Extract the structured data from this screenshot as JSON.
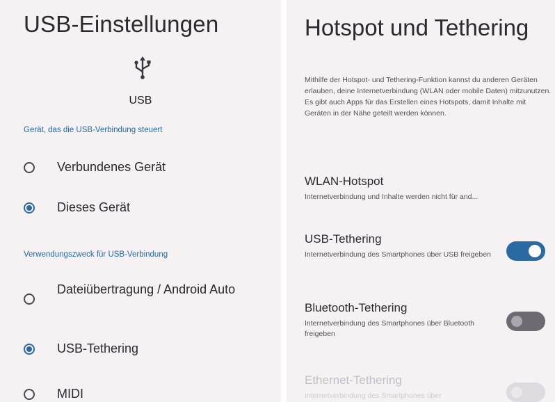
{
  "usb_settings": {
    "title": "USB-Einstellungen",
    "icon": "usb-icon",
    "usb_label": "USB",
    "controller_header": "Gerät, das die USB-Verbindung steuert",
    "controller_options": [
      {
        "label": "Verbundenes Gerät",
        "checked": false
      },
      {
        "label": "Dieses Gerät",
        "checked": true
      }
    ],
    "purpose_header": "Verwendungszweck für USB-Verbindung",
    "purpose_options": [
      {
        "label": "Dateiübertragung / Android Auto",
        "checked": false
      },
      {
        "label": "USB-Tethering",
        "checked": true
      },
      {
        "label": "MIDI",
        "checked": false
      }
    ]
  },
  "hotspot": {
    "title": "Hotspot und Tethering",
    "description": "Mithilfe der Hotspot- und Tethering-Funktion kannst du anderen Geräten erlauben, deine Internetverbindung (WLAN oder mobile Daten) mitzunutzen. Es gibt auch Apps für das Erstellen eines Hotspots, damit Inhalte mit Geräten in der Nähe geteilt werden können.",
    "items": [
      {
        "title": "WLAN-Hotspot",
        "summary": "Internetverbindung und Inhalte werden nicht für and...",
        "switch": null
      },
      {
        "title": "USB-Tethering",
        "summary": "Internetverbindung des Smartphones über USB freigeben",
        "switch": "on"
      },
      {
        "title": "Bluetooth-Tethering",
        "summary": "Internetverbindung des Smartphones über Bluetooth freigeben",
        "switch": "off"
      },
      {
        "title": "Ethernet-Tethering",
        "summary": "Internetverbindung des Smartphones über",
        "switch": "off-disabled"
      }
    ]
  },
  "colors": {
    "accent": "#2a6aa3",
    "header_text": "#1f6aa8",
    "background": "#f6f1f3"
  }
}
